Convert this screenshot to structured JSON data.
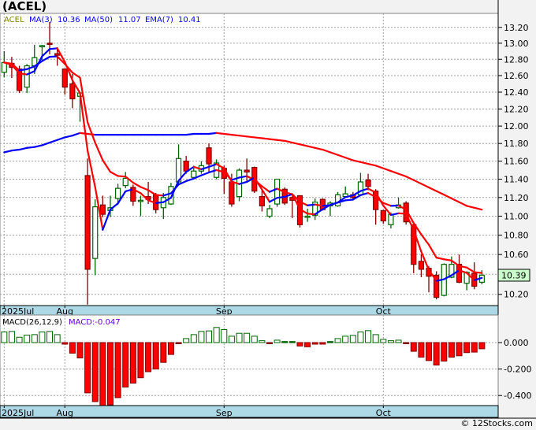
{
  "title": "(ACEL)",
  "footer": "© 12Stocks.com",
  "legend": {
    "symbol": "ACEL",
    "ma3_label": "MA(3)",
    "ma3_value": "10.36",
    "ma50_label": "MA(50)",
    "ma50_value": "11.07",
    "ema7_label": "EMA(7)",
    "ema7_value": "10.41",
    "symbol_color": "#808000",
    "legend_color": "#0000ff"
  },
  "macd_legend": {
    "label": "MACD(26,12,9)",
    "value": "MACD:-0.047",
    "value_color": "#6600cc"
  },
  "last_price": "10.39",
  "colors": {
    "up": "#006400",
    "down_fill": "#ff0000",
    "down_edge": "#800000",
    "rising_line": "#0000ff",
    "falling_line": "#ff0000",
    "axis_strip": "#add8e6",
    "last_price_bg": "#ccffcc"
  },
  "chart_data": [
    {
      "type": "candlestick",
      "yscale": "log",
      "ylim": [
        10.09,
        13.38
      ],
      "grid": true,
      "y_ticks": [
        "13.20",
        "13.00",
        "12.80",
        "12.60",
        "12.40",
        "12.20",
        "12.00",
        "11.80",
        "11.60",
        "11.40",
        "11.20",
        "11.00",
        "10.80",
        "10.60",
        "10.40",
        "10.20"
      ],
      "x_labels": [
        {
          "label": "2025Jul",
          "date": "2025-07-22"
        },
        {
          "label": "Aug",
          "date": "2025-08-01"
        },
        {
          "label": "Sep",
          "date": "2025-09-02"
        },
        {
          "label": "Oct",
          "date": "2025-10-01"
        }
      ],
      "dates": [
        "2025-07-22",
        "2025-07-23",
        "2025-07-24",
        "2025-07-25",
        "2025-07-28",
        "2025-07-29",
        "2025-07-30",
        "2025-07-31",
        "2025-08-01",
        "2025-08-04",
        "2025-08-05",
        "2025-08-06",
        "2025-08-07",
        "2025-08-08",
        "2025-08-11",
        "2025-08-12",
        "2025-08-13",
        "2025-08-14",
        "2025-08-15",
        "2025-08-18",
        "2025-08-19",
        "2025-08-20",
        "2025-08-21",
        "2025-08-22",
        "2025-08-25",
        "2025-08-26",
        "2025-08-27",
        "2025-08-28",
        "2025-08-29",
        "2025-09-02",
        "2025-09-03",
        "2025-09-04",
        "2025-09-05",
        "2025-09-08",
        "2025-09-09",
        "2025-09-10",
        "2025-09-11",
        "2025-09-12",
        "2025-09-15",
        "2025-09-16",
        "2025-09-17",
        "2025-09-18",
        "2025-09-19",
        "2025-09-22",
        "2025-09-23",
        "2025-09-24",
        "2025-09-25",
        "2025-09-26",
        "2025-09-29",
        "2025-09-30",
        "2025-10-01",
        "2025-10-02",
        "2025-10-03",
        "2025-10-06",
        "2025-10-07",
        "2025-10-08",
        "2025-10-09",
        "2025-10-10",
        "2025-10-13",
        "2025-10-14",
        "2025-10-15",
        "2025-10-16",
        "2025-10-17",
        "2025-10-20"
      ],
      "ohlc": [
        [
          12.64,
          12.9,
          12.58,
          12.76
        ],
        [
          12.75,
          12.83,
          12.57,
          12.7
        ],
        [
          12.68,
          12.72,
          12.39,
          12.42
        ],
        [
          12.46,
          12.74,
          12.39,
          12.72
        ],
        [
          12.72,
          12.98,
          12.62,
          12.82
        ],
        [
          12.96,
          12.98,
          12.78,
          12.97
        ],
        [
          13.0,
          13.27,
          12.86,
          12.99
        ],
        [
          12.87,
          12.95,
          12.72,
          12.85
        ],
        [
          12.68,
          12.68,
          12.37,
          12.46
        ],
        [
          12.5,
          12.62,
          12.21,
          12.32
        ],
        [
          12.35,
          12.4,
          12.05,
          12.39
        ],
        [
          11.44,
          11.63,
          10.1,
          10.45
        ],
        [
          10.56,
          11.18,
          10.39,
          11.1
        ],
        [
          11.12,
          11.22,
          10.99,
          11.02
        ],
        [
          11.06,
          11.22,
          10.99,
          11.09
        ],
        [
          11.19,
          11.35,
          11.12,
          11.3
        ],
        [
          11.33,
          11.48,
          11.3,
          11.41
        ],
        [
          11.31,
          11.34,
          11.11,
          11.16
        ],
        [
          11.16,
          11.22,
          11.0,
          11.17
        ],
        [
          11.21,
          11.37,
          11.13,
          11.18
        ],
        [
          11.23,
          11.25,
          11.03,
          11.07
        ],
        [
          11.09,
          11.25,
          10.97,
          11.2
        ],
        [
          11.13,
          11.36,
          11.12,
          11.32
        ],
        [
          11.37,
          11.79,
          11.35,
          11.63
        ],
        [
          11.6,
          11.66,
          11.46,
          11.49
        ],
        [
          11.42,
          11.55,
          11.4,
          11.49
        ],
        [
          11.49,
          11.6,
          11.46,
          11.55
        ],
        [
          11.75,
          11.8,
          11.48,
          11.57
        ],
        [
          11.42,
          11.62,
          11.4,
          11.58
        ],
        [
          11.52,
          11.55,
          11.24,
          11.41
        ],
        [
          11.37,
          11.46,
          11.1,
          11.13
        ],
        [
          11.21,
          11.52,
          11.16,
          11.5
        ],
        [
          11.5,
          11.63,
          11.36,
          11.48
        ],
        [
          11.53,
          11.54,
          11.25,
          11.27
        ],
        [
          11.21,
          11.28,
          11.05,
          11.11
        ],
        [
          11.0,
          11.12,
          10.98,
          11.08
        ],
        [
          11.13,
          11.4,
          11.1,
          11.4
        ],
        [
          11.29,
          11.31,
          11.12,
          11.14
        ],
        [
          11.2,
          11.24,
          10.98,
          11.17
        ],
        [
          11.22,
          11.22,
          10.88,
          10.91
        ],
        [
          10.99,
          11.08,
          10.94,
          11.0
        ],
        [
          11.01,
          11.19,
          10.96,
          11.15
        ],
        [
          11.18,
          11.19,
          11.06,
          11.07
        ],
        [
          11.11,
          11.16,
          11.0,
          11.14
        ],
        [
          11.11,
          11.26,
          11.1,
          11.23
        ],
        [
          11.21,
          11.32,
          11.2,
          11.24
        ],
        [
          11.23,
          11.26,
          11.18,
          11.2
        ],
        [
          11.23,
          11.47,
          11.22,
          11.37
        ],
        [
          11.39,
          11.46,
          11.28,
          11.32
        ],
        [
          11.27,
          11.29,
          10.91,
          11.07
        ],
        [
          11.06,
          11.06,
          10.92,
          10.95
        ],
        [
          10.91,
          11.04,
          10.87,
          11.02
        ],
        [
          11.09,
          11.2,
          11.08,
          11.12
        ],
        [
          11.14,
          11.16,
          10.91,
          10.94
        ],
        [
          10.91,
          10.91,
          10.41,
          10.5
        ],
        [
          10.53,
          10.6,
          10.37,
          10.45
        ],
        [
          10.46,
          10.48,
          10.22,
          10.38
        ],
        [
          10.39,
          10.43,
          10.15,
          10.17
        ],
        [
          10.19,
          10.51,
          10.18,
          10.5
        ],
        [
          10.37,
          10.58,
          10.36,
          10.5
        ],
        [
          10.5,
          10.6,
          10.31,
          10.32
        ],
        [
          10.31,
          10.43,
          10.24,
          10.42
        ],
        [
          10.41,
          10.52,
          10.25,
          10.28
        ],
        [
          10.32,
          10.44,
          10.3,
          10.39
        ]
      ],
      "ma50": [
        11.7,
        11.72,
        11.73,
        11.75,
        11.76,
        11.78,
        11.81,
        11.84,
        11.87,
        11.89,
        11.92,
        11.91,
        11.9,
        11.9,
        11.9,
        11.9,
        11.9,
        11.9,
        11.9,
        11.9,
        11.9,
        11.9,
        11.9,
        11.9,
        11.9,
        11.91,
        11.91,
        11.91,
        11.92,
        11.91,
        11.9,
        11.89,
        11.88,
        11.87,
        11.86,
        11.85,
        11.84,
        11.83,
        11.81,
        11.79,
        11.77,
        11.75,
        11.73,
        11.7,
        11.67,
        11.64,
        11.61,
        11.59,
        11.57,
        11.55,
        11.52,
        11.49,
        11.46,
        11.43,
        11.39,
        11.35,
        11.31,
        11.27,
        11.23,
        11.19,
        11.15,
        11.11,
        11.09,
        11.07
      ],
      "overlays": [
        "MA(3)",
        "MA(50)",
        "EMA(7)"
      ]
    },
    {
      "type": "bar",
      "name": "MACD(26,12,9)",
      "ylim": [
        -0.476,
        0.208
      ],
      "grid": true,
      "y_ticks": [
        "0.000",
        "-0.200",
        "-0.400"
      ],
      "x_labels": [
        "2025Jul",
        "Aug",
        "Sep",
        "Oct"
      ],
      "values": [
        0.08,
        0.084,
        0.04,
        0.056,
        0.06,
        0.08,
        0.084,
        0.06,
        -0.012,
        -0.08,
        -0.116,
        -0.38,
        -0.446,
        -0.486,
        -0.47,
        -0.416,
        -0.336,
        -0.306,
        -0.266,
        -0.22,
        -0.2,
        -0.15,
        -0.09,
        -0.006,
        0.03,
        0.06,
        0.084,
        0.088,
        0.114,
        0.098,
        0.048,
        0.07,
        0.07,
        0.048,
        0.014,
        -0.006,
        0.018,
        0.008,
        0.008,
        -0.026,
        -0.032,
        -0.012,
        -0.012,
        0.008,
        0.03,
        0.048,
        0.054,
        0.08,
        0.09,
        0.06,
        0.024,
        0.014,
        0.018,
        -0.002,
        -0.066,
        -0.11,
        -0.136,
        -0.17,
        -0.14,
        -0.11,
        -0.1,
        -0.076,
        -0.072,
        -0.047
      ]
    }
  ]
}
